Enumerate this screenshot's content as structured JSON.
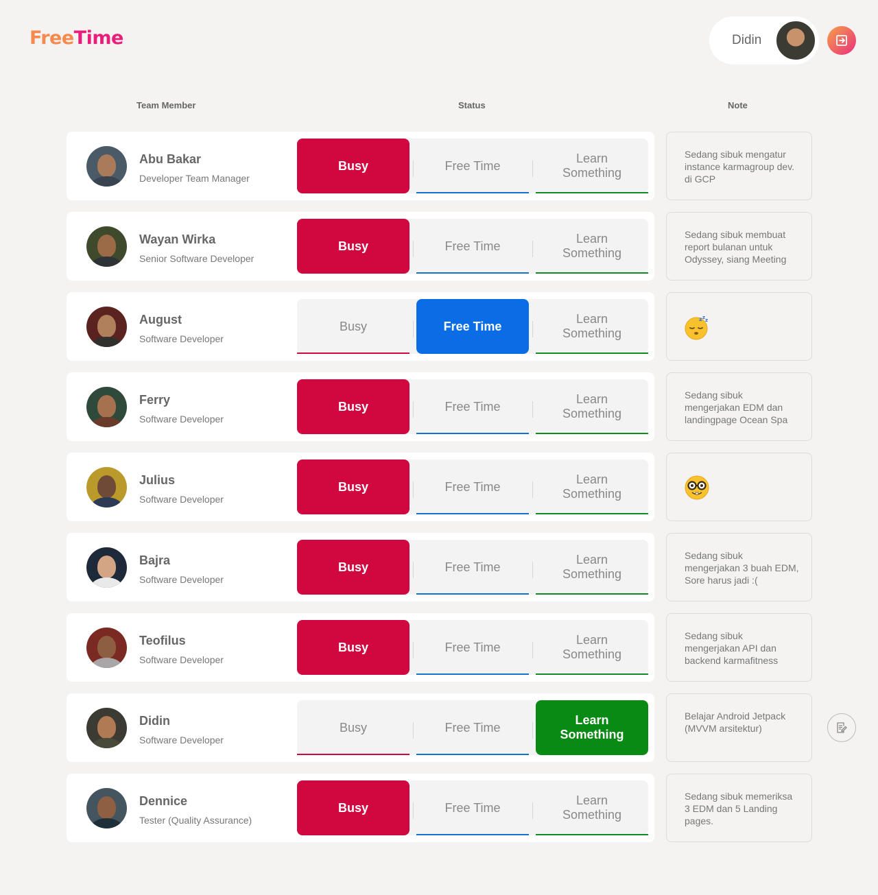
{
  "brand": {
    "word1": "Free",
    "word2": "Time"
  },
  "user": {
    "name": "Didin"
  },
  "headers": {
    "member": "Team Member",
    "status": "Status",
    "note": "Note"
  },
  "status_options": {
    "busy": "Busy",
    "free": "Free Time",
    "learn": "Learn Something"
  },
  "colors": {
    "busy": "#d0083f",
    "free": "#0a6de6",
    "learn": "#098a14",
    "accent_start": "#f6a04a",
    "accent_end": "#ea2f7d"
  },
  "members": [
    {
      "name": "Abu Bakar",
      "role": "Developer Team Manager",
      "status": "busy",
      "note": "Sedang sibuk mengatur instance karmagroup dev. di GCP",
      "note_emoji": ""
    },
    {
      "name": "Wayan Wirka",
      "role": "Senior Software Developer",
      "status": "busy",
      "note": "Sedang sibuk membuat report bulanan untuk Odyssey, siang Meeting",
      "note_emoji": ""
    },
    {
      "name": "August",
      "role": "Software Developer",
      "status": "free",
      "note": "",
      "note_emoji": "sleeping-face"
    },
    {
      "name": "Ferry",
      "role": "Software Developer",
      "status": "busy",
      "note": "Sedang sibuk mengerjakan EDM dan landingpage Ocean Spa",
      "note_emoji": ""
    },
    {
      "name": "Julius",
      "role": "Software Developer",
      "status": "busy",
      "note": "",
      "note_emoji": "nerd-face"
    },
    {
      "name": "Bajra",
      "role": "Software Developer",
      "status": "busy",
      "note": "Sedang sibuk mengerjakan 3 buah EDM, Sore harus jadi :(",
      "note_emoji": ""
    },
    {
      "name": "Teofilus",
      "role": "Software Developer",
      "status": "busy",
      "note": "Sedang sibuk mengerjakan API dan backend karmafitness",
      "note_emoji": ""
    },
    {
      "name": "Didin",
      "role": "Software Developer",
      "status": "learn",
      "note": "Belajar Android Jetpack (MVVM arsitektur)",
      "note_emoji": ""
    },
    {
      "name": "Dennice",
      "role": "Tester (Quality Assurance)",
      "status": "busy",
      "note": "Sedang sibuk memeriksa 3 EDM dan 5 Landing pages.",
      "note_emoji": ""
    }
  ]
}
